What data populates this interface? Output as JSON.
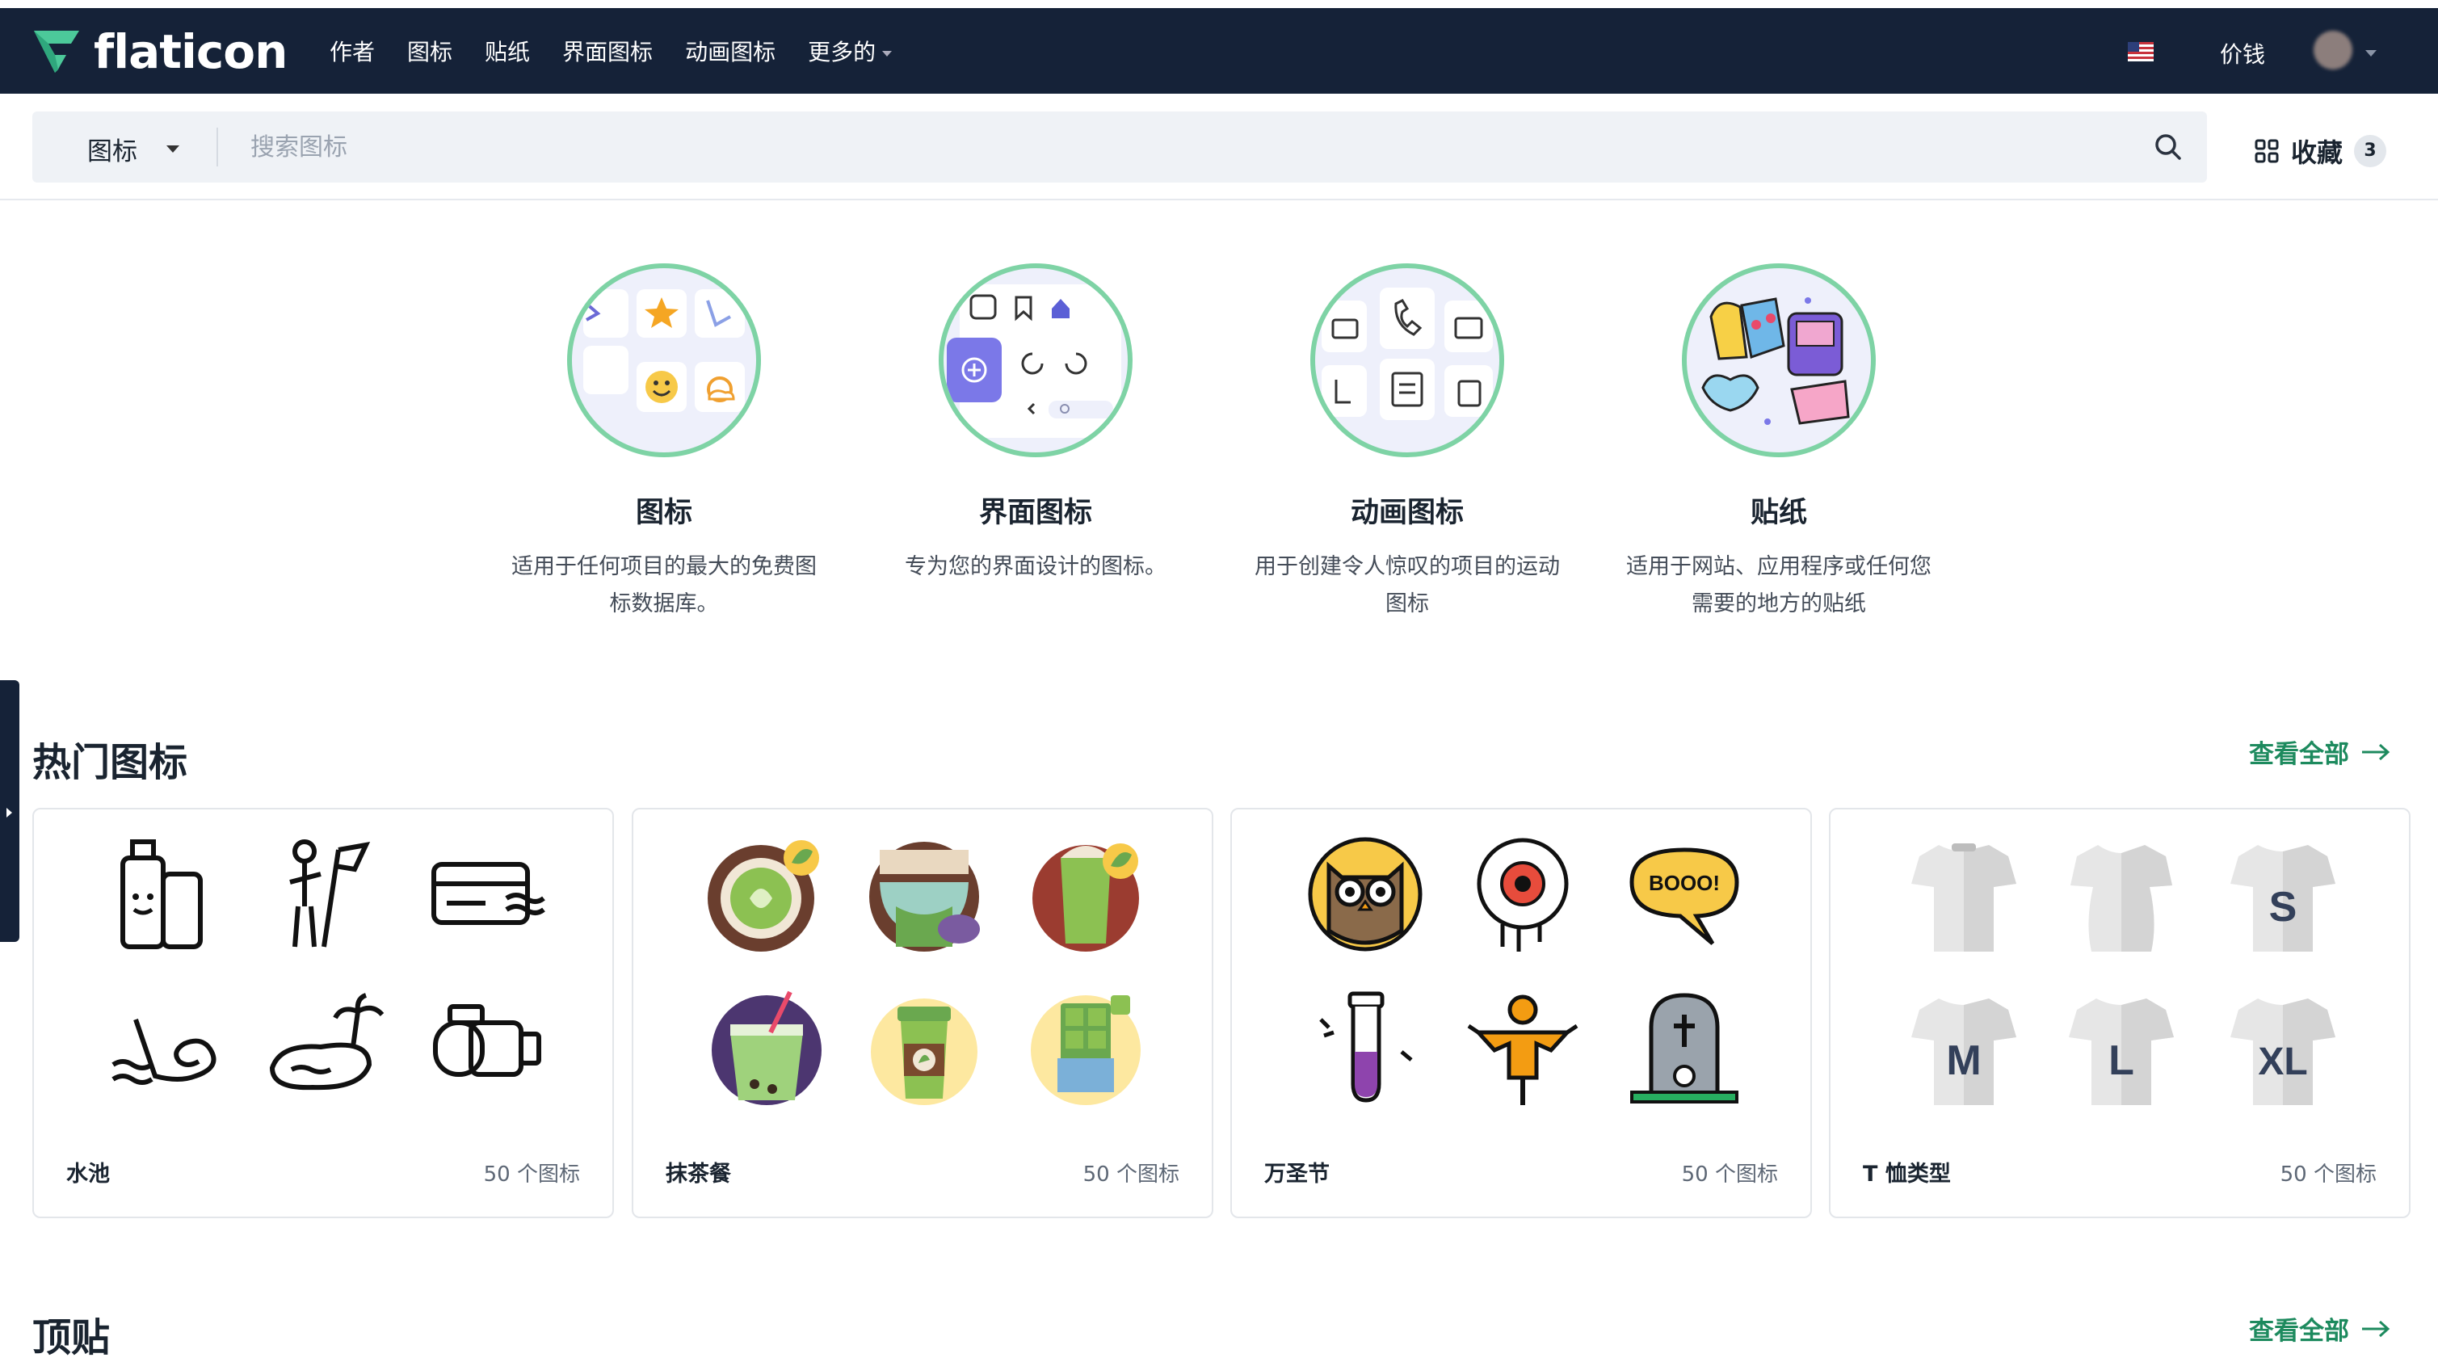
{
  "brand": {
    "name": "flaticon"
  },
  "nav": {
    "items": [
      "作者",
      "图标",
      "贴纸",
      "界面图标",
      "动画图标",
      "更多的"
    ],
    "price": "价钱"
  },
  "search": {
    "type_label": "图标",
    "placeholder": "搜索图标",
    "value": ""
  },
  "collections": {
    "label": "收藏",
    "count": "3"
  },
  "categories": [
    {
      "title": "图标",
      "desc": "适用于任何项目的最大的免费图标数据库。"
    },
    {
      "title": "界面图标",
      "desc": "专为您的界面设计的图标。"
    },
    {
      "title": "动画图标",
      "desc": "用于创建令人惊叹的项目的运动图标"
    },
    {
      "title": "贴纸",
      "desc": "适用于网站、应用程序或任何您需要的地方的贴纸"
    }
  ],
  "popular": {
    "title": "热门图标",
    "view_all": "查看全部"
  },
  "packs": [
    {
      "name": "水池",
      "count": "50 个图标"
    },
    {
      "name": "抹茶餐",
      "count": "50 个图标"
    },
    {
      "name": "万圣节",
      "count": "50 个图标"
    },
    {
      "name": "T 恤类型",
      "count": "50 个图标"
    }
  ],
  "tshirt_labels": [
    "S",
    "M",
    "L",
    "XL"
  ],
  "halloween_bubble": "BOOO!",
  "top_stickers": {
    "title": "顶贴",
    "view_all": "查看全部"
  },
  "colors": {
    "navbar": "#152238",
    "accent_green": "#1d8a5e",
    "circle_border": "#7ed3a5"
  }
}
